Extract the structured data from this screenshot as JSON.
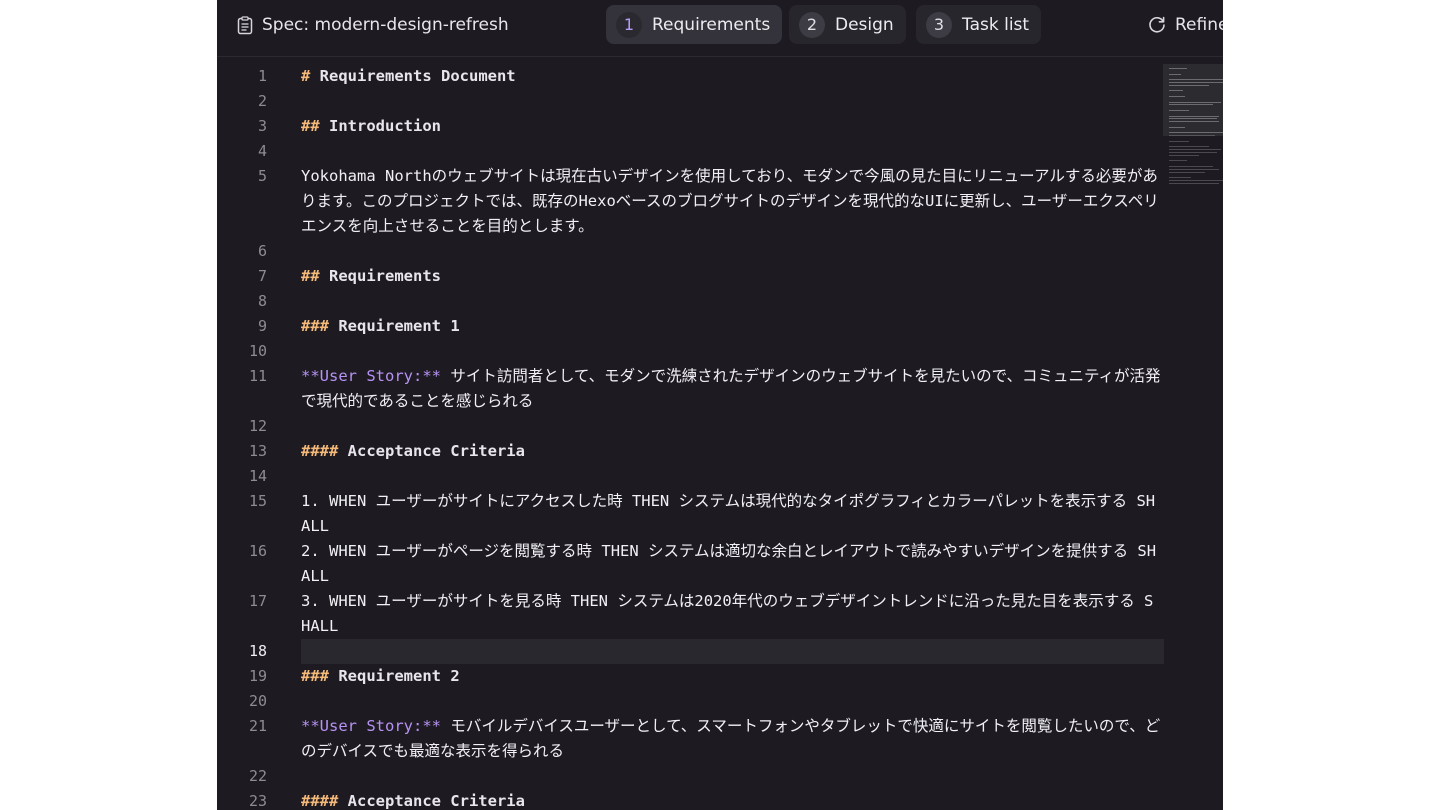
{
  "header": {
    "spec_title": "Spec: modern-design-refresh",
    "tabs": [
      {
        "num": "1",
        "label": "Requirements"
      },
      {
        "num": "2",
        "label": "Design"
      },
      {
        "num": "3",
        "label": "Task list"
      }
    ],
    "refine_label": "Refine"
  },
  "editor": {
    "current_line": 18,
    "lines": [
      {
        "n": "1",
        "prefix": "#",
        "text": " Requirements Document"
      },
      {
        "n": "2",
        "text": ""
      },
      {
        "n": "3",
        "prefix": "##",
        "text": " Introduction"
      },
      {
        "n": "4",
        "text": ""
      },
      {
        "n": "5",
        "text": "Yokohama Northのウェブサイトは現在古いデザインを使用しており、モダンで今風の見た目にリニューアルする必要があります。このプロジェクトでは、既存のHexoベースのブログサイトのデザインを現代的なUIに更新し、ユーザーエクスペリエンスを向上させることを目的とします。"
      },
      {
        "n": "6",
        "text": ""
      },
      {
        "n": "7",
        "prefix": "##",
        "text": " Requirements"
      },
      {
        "n": "8",
        "text": ""
      },
      {
        "n": "9",
        "prefix": "###",
        "text": " Requirement 1"
      },
      {
        "n": "10",
        "text": ""
      },
      {
        "n": "11",
        "bold": "**User Story:**",
        "text": " サイト訪問者として、モダンで洗練されたデザインのウェブサイトを見たいので、コミュニティが活発で現代的であることを感じられる"
      },
      {
        "n": "12",
        "text": ""
      },
      {
        "n": "13",
        "prefix": "####",
        "text": " Acceptance Criteria"
      },
      {
        "n": "14",
        "text": ""
      },
      {
        "n": "15",
        "text": "1. WHEN ユーザーがサイトにアクセスした時 THEN システムは現代的なタイポグラフィとカラーパレットを表示する SHALL"
      },
      {
        "n": "16",
        "text": "2. WHEN ユーザーがページを閲覧する時 THEN システムは適切な余白とレイアウトで読みやすいデザインを提供する SHALL"
      },
      {
        "n": "17",
        "text": "3. WHEN ユーザーがサイトを見る時 THEN システムは2020年代のウェブデザイントレンドに沿った見た目を表示する SHALL"
      },
      {
        "n": "18",
        "text": ""
      },
      {
        "n": "19",
        "prefix": "###",
        "text": " Requirement 2"
      },
      {
        "n": "20",
        "text": ""
      },
      {
        "n": "21",
        "bold": "**User Story:**",
        "text": " モバイルデバイスユーザーとして、スマートフォンやタブレットで快適にサイトを閲覧したいので、どのデバイスでも最適な表示を得られる"
      },
      {
        "n": "22",
        "text": ""
      },
      {
        "n": "23",
        "prefix": "####",
        "text": " Acceptance Criteria"
      }
    ]
  },
  "colors": {
    "background": "#1d1b21",
    "heading_marker": "#f5b97a",
    "bold_marker": "#b792f5",
    "accent_tab_number": "#b49cf5"
  }
}
